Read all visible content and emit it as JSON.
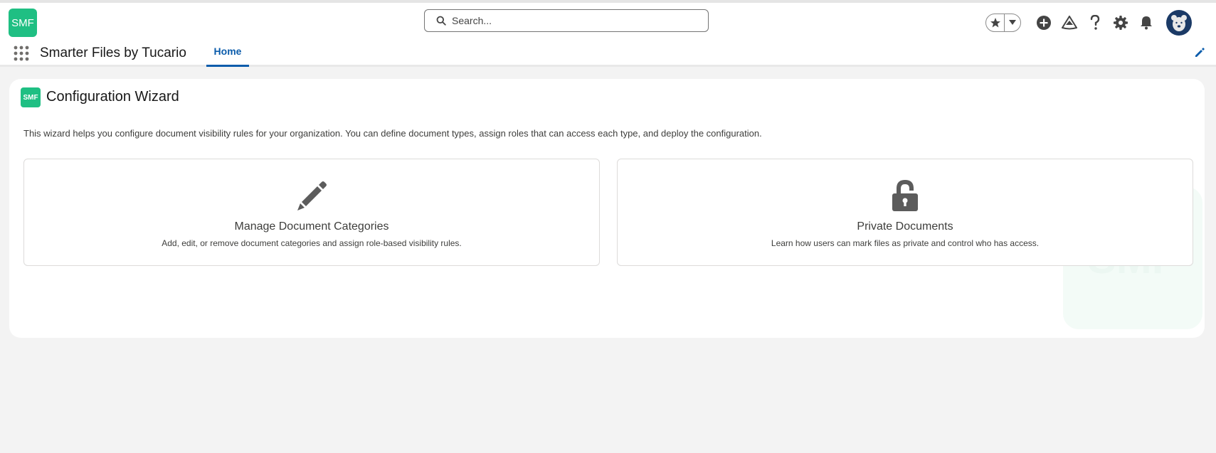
{
  "header": {
    "logo_text": "SMF",
    "search_placeholder": "Search...",
    "icons": [
      "favorites-star-icon",
      "favorites-dropdown-icon",
      "global-actions-plus-icon",
      "trailhead-icon",
      "help-icon",
      "setup-gear-icon",
      "notifications-bell-icon",
      "user-avatar"
    ],
    "brand_color": "#1fbf83"
  },
  "nav": {
    "app_name": "Smarter Files by Tucario",
    "tabs": [
      {
        "label": "Home",
        "active": true
      }
    ],
    "accent_color": "#0b5cab"
  },
  "main": {
    "logo_text": "SMF",
    "title": "Configuration Wizard",
    "description": "This wizard helps you configure document visibility rules for your organization. You can define document types, assign roles that can access each type, and deploy the configuration.",
    "tiles": [
      {
        "icon": "pencil-icon",
        "title": "Manage Document Categories",
        "subtitle": "Add, edit, or remove document categories and assign role-based visibility rules."
      },
      {
        "icon": "lock-icon",
        "title": "Private Documents",
        "subtitle": "Learn how users can mark files as private and control who has access."
      }
    ],
    "watermark_text": "SMF"
  }
}
